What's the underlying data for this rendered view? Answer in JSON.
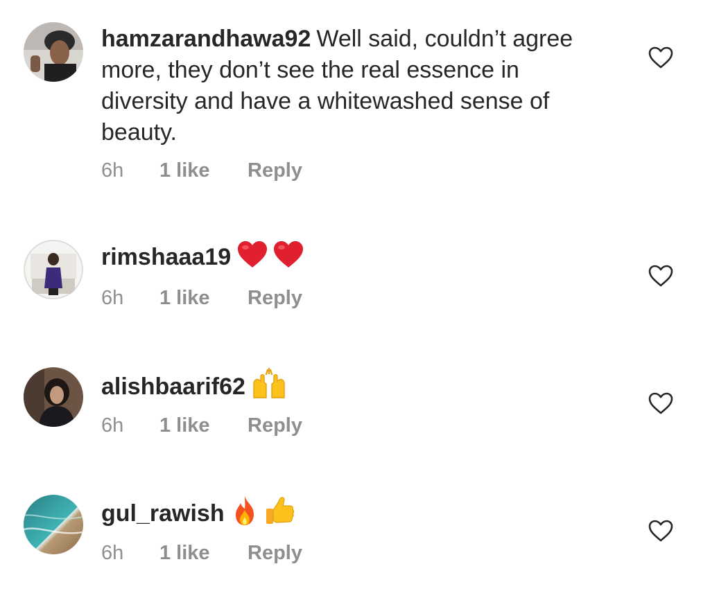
{
  "comments": [
    {
      "username": "hamzarandhawa92",
      "text": "Well said, couldn’t agree more, they don’t see the real essence in diversity and have a whitewashed sense of beauty.",
      "time": "6h",
      "likes": "1 like",
      "reply": "Reply",
      "emojis": []
    },
    {
      "username": "rimshaaa19",
      "text": "",
      "time": "6h",
      "likes": "1 like",
      "reply": "Reply",
      "emojis": [
        "red-heart",
        "red-heart"
      ]
    },
    {
      "username": "alishbaarif62",
      "text": "",
      "time": "6h",
      "likes": "1 like",
      "reply": "Reply",
      "emojis": [
        "raising-hands"
      ]
    },
    {
      "username": "gul_rawish",
      "text": "",
      "time": "6h",
      "likes": "1 like",
      "reply": "Reply",
      "emojis": [
        "fire",
        "thumbs-up"
      ]
    }
  ],
  "icons": {
    "like": "heart-outline-icon"
  },
  "colors": {
    "text": "#262626",
    "meta": "#8e8e8e",
    "heart_red": "#e0202e"
  }
}
